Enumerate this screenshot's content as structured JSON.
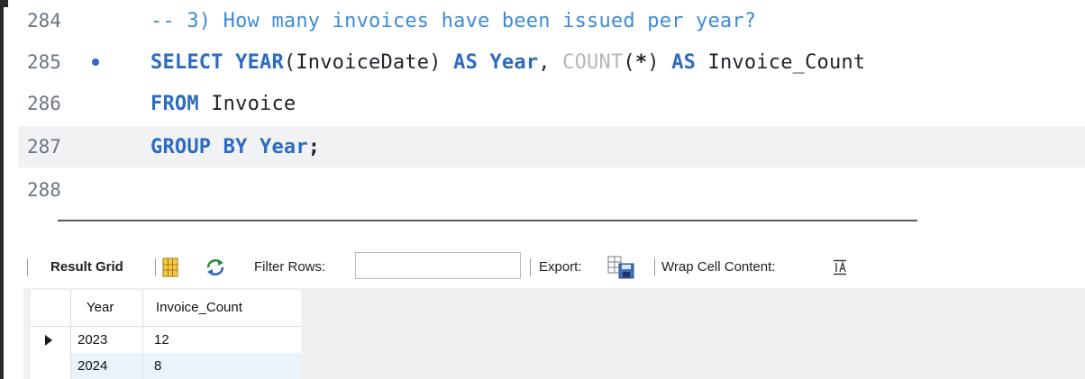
{
  "editor": {
    "lines": [
      {
        "number": "284",
        "tokens": [
          {
            "type": "comment",
            "text": "-- 3) How many invoices have been issued per year?"
          }
        ]
      },
      {
        "number": "285",
        "marker": true,
        "tokens": [
          {
            "type": "keyword",
            "text": "SELECT "
          },
          {
            "type": "func-kw",
            "text": "YEAR"
          },
          {
            "type": "plain",
            "text": "(InvoiceDate) "
          },
          {
            "type": "keyword",
            "text": "AS "
          },
          {
            "type": "keyword",
            "text": "Year"
          },
          {
            "type": "plain",
            "text": ", "
          },
          {
            "type": "func",
            "text": "COUNT"
          },
          {
            "type": "plain",
            "text": "("
          },
          {
            "type": "bold-plain",
            "text": "*"
          },
          {
            "type": "plain",
            "text": ") "
          },
          {
            "type": "keyword",
            "text": "AS "
          },
          {
            "type": "plain",
            "text": "Invoice_Count"
          }
        ]
      },
      {
        "number": "286",
        "tokens": [
          {
            "type": "keyword",
            "text": "FROM "
          },
          {
            "type": "plain",
            "text": "Invoice"
          }
        ]
      },
      {
        "number": "287",
        "current": true,
        "tokens": [
          {
            "type": "keyword",
            "text": "GROUP BY "
          },
          {
            "type": "keyword",
            "text": "Year"
          },
          {
            "type": "bold-plain",
            "text": ";"
          }
        ]
      },
      {
        "number": "288",
        "tokens": []
      }
    ]
  },
  "toolbar": {
    "result_grid_label": "Result Grid",
    "filter_label": "Filter Rows:",
    "filter_value": "",
    "export_label": "Export:",
    "wrap_label": "Wrap Cell Content:",
    "icons": {
      "grid": "grid-icon",
      "refresh": "refresh-icon",
      "export": "export-icon",
      "wrap": "wrap-icon"
    }
  },
  "grid": {
    "columns": [
      "Year",
      "Invoice_Count"
    ],
    "rows": [
      {
        "year": "2023",
        "count": "12"
      },
      {
        "year": "2024",
        "count": "8"
      }
    ]
  },
  "colors": {
    "keyword": "#2d6bc1",
    "comment": "#3e8bd6",
    "current_line": "#f1f2f4",
    "selected_row": "#eaf2fb"
  }
}
